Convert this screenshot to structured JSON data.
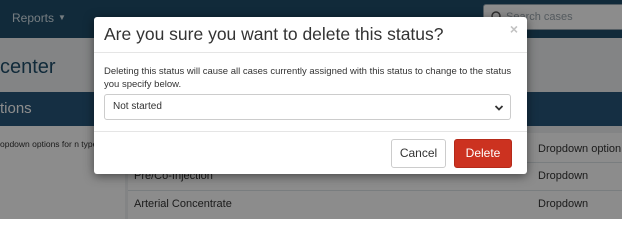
{
  "topnav": {
    "reports_label": "Reports",
    "search_placeholder": "Search cases"
  },
  "page": {
    "title_fragment": "center",
    "panel_header_fragment": "tions",
    "panel_desc": "opdown options for n types."
  },
  "table": {
    "rows": [
      {
        "name": "",
        "type": "Dropdown option"
      },
      {
        "name": "Pre/Co-Injection",
        "type": "Dropdown"
      },
      {
        "name": "Arterial Concentrate",
        "type": "Dropdown"
      }
    ]
  },
  "modal": {
    "title": "Are you sure you want to delete this status?",
    "close_label": "×",
    "message": "Deleting this status will cause all cases currently assigned with this status to change to the status you specify below.",
    "selected_status": "Not started",
    "cancel_label": "Cancel",
    "delete_label": "Delete"
  },
  "colors": {
    "topbar": "#1f4e6a",
    "panel_header": "#27577a",
    "delete_button": "#cc3220"
  }
}
